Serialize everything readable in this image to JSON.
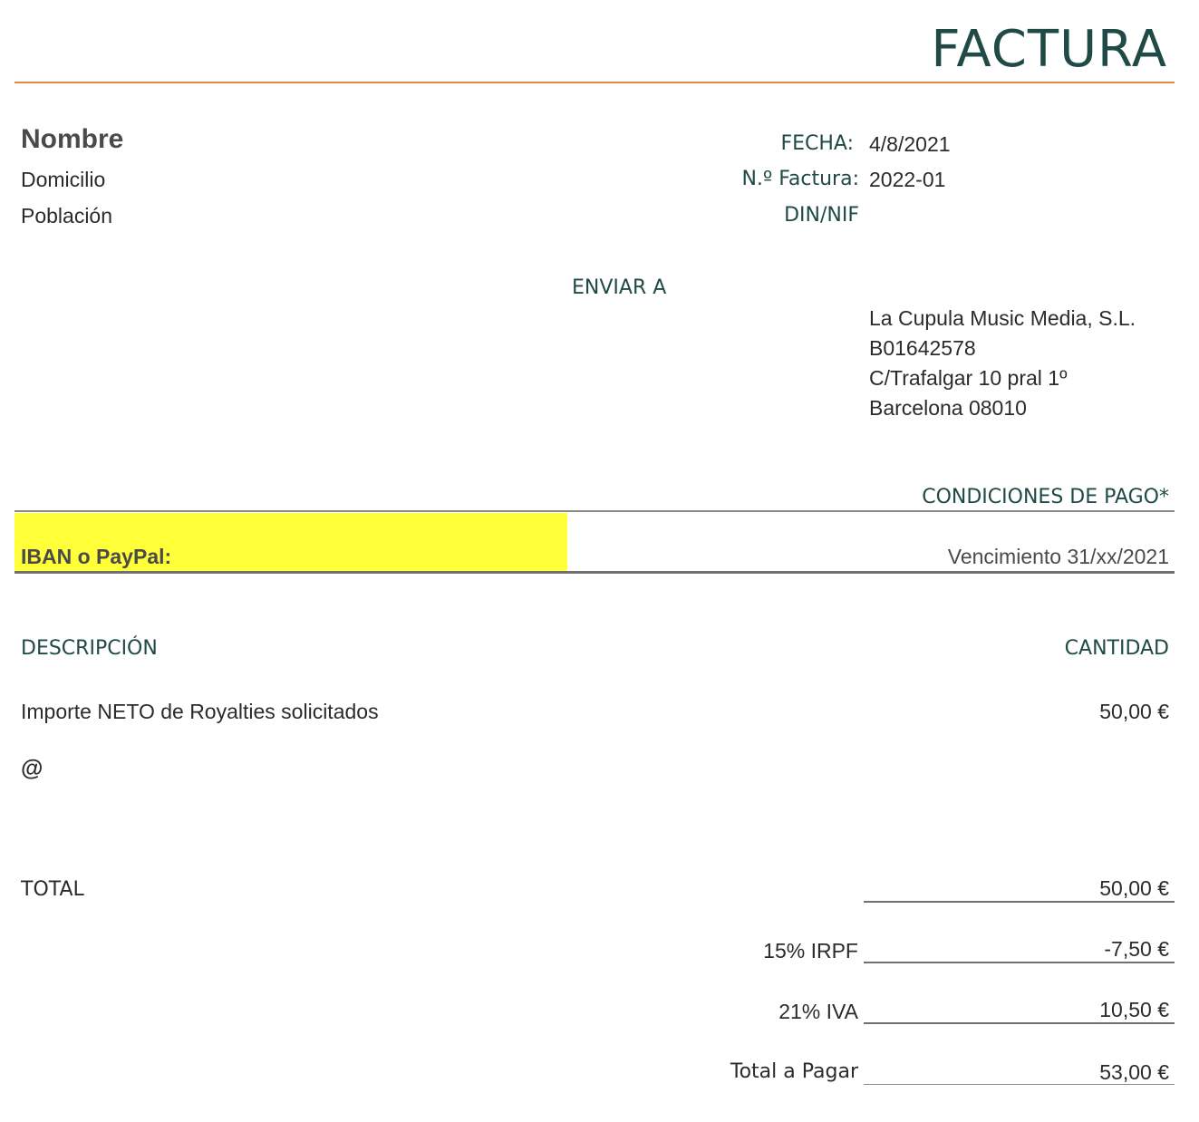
{
  "header": {
    "title": "FACTURA"
  },
  "sender": {
    "name": "Nombre",
    "address": "Domicilio",
    "city": "Población"
  },
  "meta": {
    "date_label": "FECHA:",
    "date_value": "4/8/2021",
    "invoice_label": "N.º Factura:",
    "invoice_value": "2022-01",
    "nif_label": "DIN/NIF"
  },
  "recipient": {
    "label": "ENVIAR A",
    "line1": "La Cupula Music Media, S.L.",
    "line2": "B01642578",
    "line3": "C/Trafalgar 10 pral 1º",
    "line4": "Barcelona 08010"
  },
  "payment": {
    "label": "CONDICIONES DE PAGO*",
    "iban_label": "IBAN o PayPal:",
    "due": "Vencimiento 31/xx/2021"
  },
  "items": {
    "description_header": "DESCRIPCIÓN",
    "amount_header": "CANTIDAD",
    "rows": [
      {
        "description": "Importe NETO de Royalties solicitados",
        "amount": "50,00 €"
      },
      {
        "description": "@",
        "amount": ""
      }
    ]
  },
  "totals": {
    "total_label": "TOTAL",
    "total_value": "50,00 €",
    "irpf_label": "15% IRPF",
    "irpf_value": "-7,50 €",
    "iva_label": "21% IVA",
    "iva_value": "10,50 €",
    "grand_label": "Total a Pagar",
    "grand_value": "53,00 €"
  },
  "colors": {
    "accent_teal": "#1f4a45",
    "accent_orange": "#e0894a",
    "highlight_yellow": "#ffff3a"
  }
}
